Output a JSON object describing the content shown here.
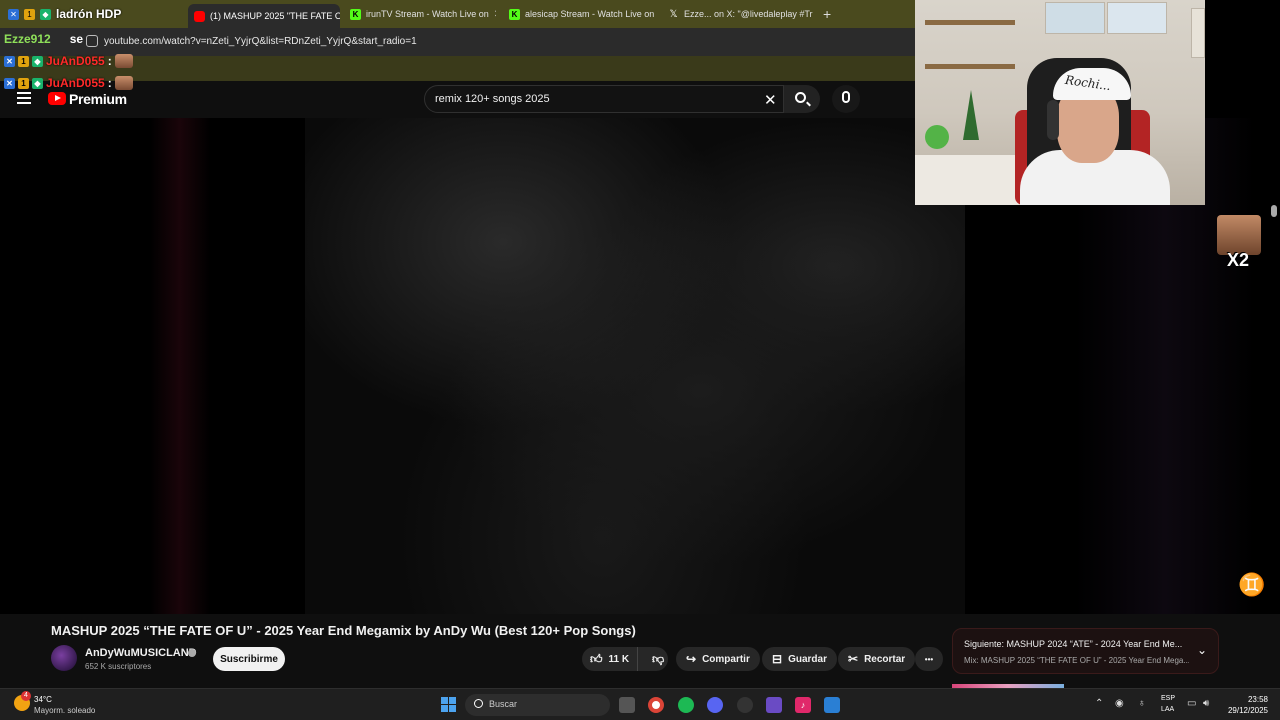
{
  "browser": {
    "tabs": [
      {
        "label": "ladrón HDP",
        "favicon": "twitch-chat",
        "active": false
      },
      {
        "label": "(1) MASHUP 2025 \"THE FATE OF",
        "favicon": "youtube-icon",
        "active": true
      },
      {
        "label": "irunTV Stream - Watch Live on",
        "favicon": "kick-icon",
        "active": false
      },
      {
        "label": "alesicap Stream - Watch Live on",
        "favicon": "kick-icon",
        "active": false
      },
      {
        "label": "Ezze... on X: \"@livedaleplay #Tr",
        "favicon": "x-icon",
        "active": false
      }
    ],
    "close_glyph": "✕",
    "new_tab": "+",
    "url": "youtube.com/watch?v=nZeti_YyjrQ&list=RDnZeti_YyjrQ&start_radio=1"
  },
  "chat": [
    {
      "user": "ladrón HDP",
      "user_prefix": "",
      "message": "",
      "user_color": "#ff2a2a"
    },
    {
      "user": "Ezze912",
      "message": "se",
      "user_color": "#8fe05a"
    },
    {
      "user": "JuAnD055",
      "message": ":",
      "user_color": "#ff2a2a"
    },
    {
      "user": "JuAnD055",
      "message": ":",
      "user_color": "#ff2a2a"
    }
  ],
  "youtube": {
    "brand": "Premium",
    "search_query": "remix 120+ songs 2025",
    "video_title": "MASHUP 2025 “THE FATE OF U” - 2025 Year End Megamix by AnDy Wu (Best 120+ Pop Songs)",
    "channel_name": "AnDyWuMUSICLAND",
    "subscribers": "652 K suscriptores",
    "subscribe_label": "Suscribirme",
    "likes": "11 K",
    "share_label": "Compartir",
    "save_label": "Guardar",
    "clip_label": "Recortar",
    "more_label": "•••",
    "up_next_title": "Siguiente: MASHUP 2024 “ATE” - 2024 Year End Me...",
    "up_next_sub": "Mix: MASHUP 2025 “THE FATE OF U” - 2025 Year End Mega...",
    "overlay_emote_label": "X2",
    "webcam_cap_text": "Rochi..."
  },
  "taskbar": {
    "weather_badge": "4",
    "temperature": "34°C",
    "condition": "Mayorm. soleado",
    "search_placeholder": "Buscar",
    "lang_1": "ESP",
    "lang_2": "LAA",
    "time": "23:58",
    "date": "29/12/2025"
  },
  "colors": {
    "accent_red": "#ff0000",
    "kick_green": "#53fc18",
    "chrome_bg": "#4a4a1e"
  }
}
